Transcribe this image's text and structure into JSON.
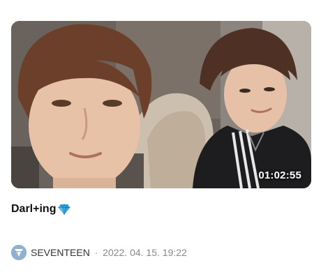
{
  "video": {
    "duration": "01:02:55",
    "title": "Darl+ing",
    "title_icon": "gem-icon",
    "channel": {
      "name": "SEVENTEEN",
      "avatar_icon": "seventeen-logo-icon",
      "avatar_color": "#8fb1cf"
    },
    "separator": "·",
    "date": "2022. 04. 15. 19:22"
  },
  "colors": {
    "title": "#111111",
    "meta": "#888888",
    "gem": "#3aa7e0"
  }
}
